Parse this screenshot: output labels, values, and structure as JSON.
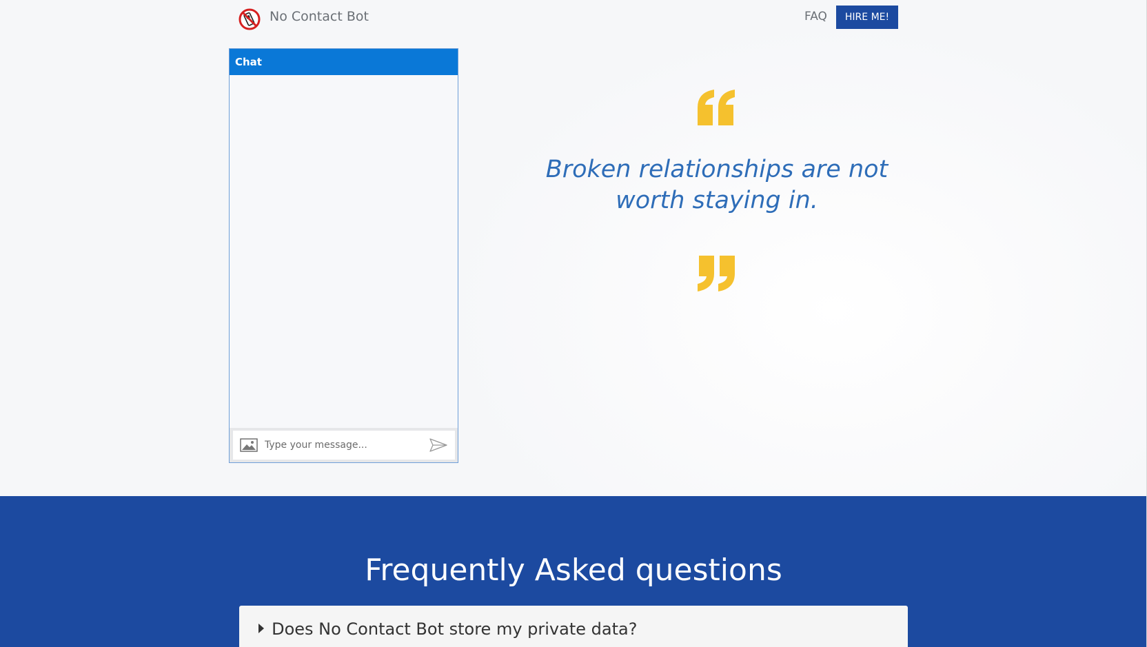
{
  "header": {
    "brand": "No Contact Bot",
    "logo_icon": "no-phone-icon",
    "faq_link": "FAQ",
    "hire_button": "HIRE ME!"
  },
  "chat": {
    "title": "Chat",
    "input_placeholder": "Type your message...",
    "attach_icon": "image-icon",
    "send_icon": "send-icon"
  },
  "quote": {
    "text": "Broken relationships are not worth staying in.",
    "accent_color": "#F5C12E"
  },
  "faq": {
    "title": "Frequently Asked questions",
    "items": [
      {
        "question": "Does No Contact Bot store my private data?"
      }
    ]
  },
  "colors": {
    "primary": "#1C4AA0",
    "chat_header": "#0A78D7",
    "quote_text": "#2E6DB8"
  }
}
